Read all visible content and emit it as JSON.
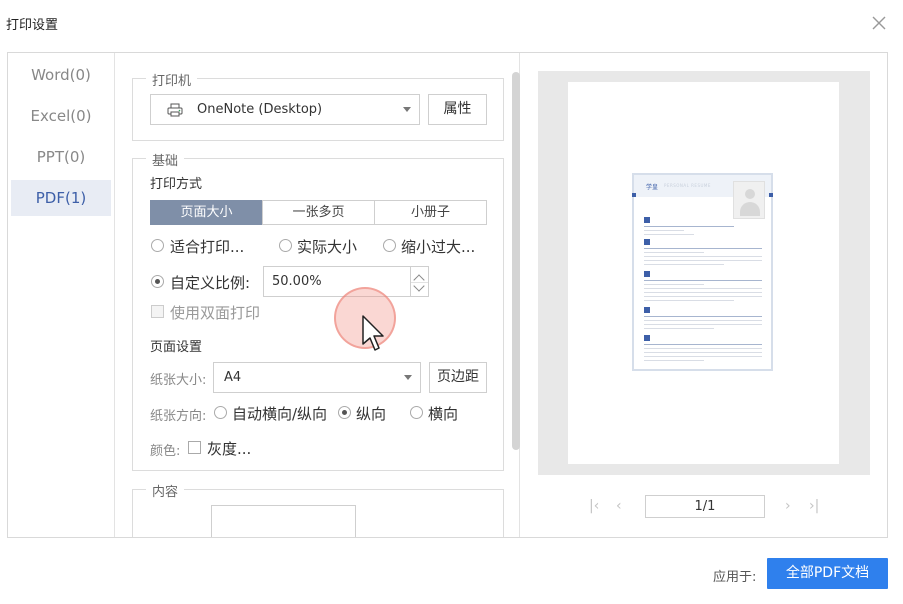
{
  "dialog": {
    "title": "打印设置"
  },
  "categories": [
    {
      "label": "Word(0)"
    },
    {
      "label": "Excel(0)"
    },
    {
      "label": "PPT(0)"
    },
    {
      "label": "PDF(1)"
    }
  ],
  "printer": {
    "legend": "打印机",
    "selected": "OneNote (Desktop)",
    "properties_label": "属性"
  },
  "basics": {
    "legend": "基础",
    "print_mode_label": "打印方式",
    "modes": [
      "页面大小",
      "一张多页",
      "小册子"
    ],
    "active_mode": "页面大小",
    "scaling": {
      "fit": "适合打印...",
      "actual": "实际大小",
      "shrink": "缩小过大...",
      "custom": "自定义比例:",
      "custom_value": "50.00%"
    },
    "duplex_label": "使用双面打印",
    "page_setup_label": "页面设置",
    "paper_size_label": "纸张大小:",
    "paper_size_value": "A4",
    "margins_label": "页边距",
    "orientation_label": "纸张方向:",
    "orientation_auto": "自动横向/纵向",
    "orientation_portrait": "纵向",
    "orientation_landscape": "横向",
    "color_label": "颜色:",
    "grayscale_label": "灰度..."
  },
  "content": {
    "legend": "内容"
  },
  "preview": {
    "thumb_name": "学皇",
    "thumb_sub": "PERSONAL RESUME",
    "page_indicator": "1/1"
  },
  "footer": {
    "apply_label": "应用于:",
    "apply_button": "全部PDF文档"
  },
  "colors": {
    "accent": "#2f80ed",
    "active_segment": "#7f8fa8",
    "active_category_bg": "#e8ecf4",
    "active_category_text": "#3d5fa8"
  },
  "icons": [
    "close-icon",
    "printer-icon",
    "chevron-down-icon",
    "chevron-up-icon",
    "first-page-icon",
    "prev-page-icon",
    "next-page-icon",
    "last-page-icon",
    "mouse-cursor-icon"
  ]
}
